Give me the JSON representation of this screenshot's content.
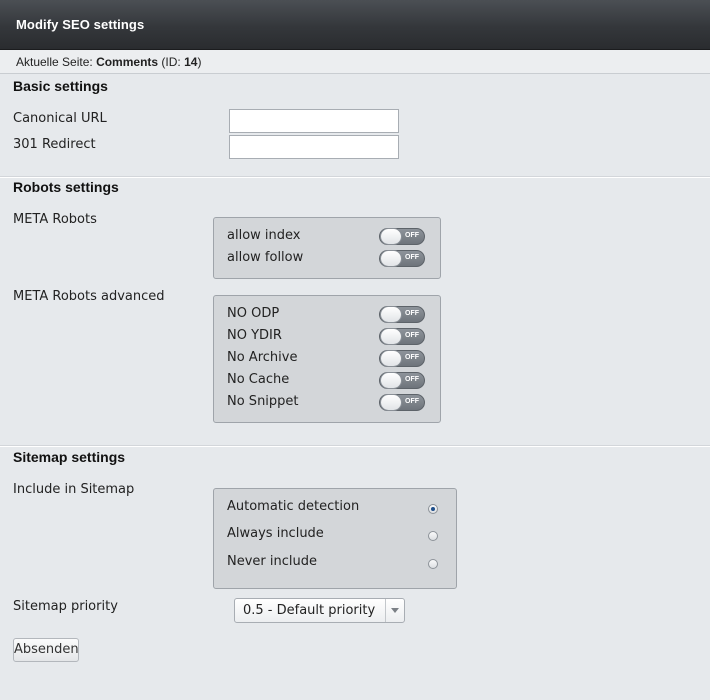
{
  "window": {
    "title": "Modify SEO settings"
  },
  "page_info": {
    "prefix": "Aktuelle Seite:",
    "page_name": "Comments",
    "id_prefix": "(ID:",
    "id_value": "14",
    "id_suffix": ")"
  },
  "basic": {
    "heading": "Basic settings",
    "canonical_label": "Canonical URL",
    "canonical_value": "",
    "redirect_label": "301 Redirect",
    "redirect_value": ""
  },
  "robots": {
    "heading": "Robots settings",
    "meta_label": "META Robots",
    "meta_options": [
      {
        "label": "allow index",
        "state": "OFF"
      },
      {
        "label": "allow follow",
        "state": "OFF"
      }
    ],
    "advanced_label": "META Robots advanced",
    "advanced_options": [
      {
        "label": "NO ODP",
        "state": "OFF"
      },
      {
        "label": "NO YDIR",
        "state": "OFF"
      },
      {
        "label": "No Archive",
        "state": "OFF"
      },
      {
        "label": "No Cache",
        "state": "OFF"
      },
      {
        "label": "No Snippet",
        "state": "OFF"
      }
    ]
  },
  "sitemap": {
    "heading": "Sitemap settings",
    "include_label": "Include in Sitemap",
    "include_options": [
      {
        "label": "Automatic detection",
        "selected": true
      },
      {
        "label": "Always include",
        "selected": false
      },
      {
        "label": "Never include",
        "selected": false
      }
    ],
    "priority_label": "Sitemap priority",
    "priority_value": "0.5 - Default priority"
  },
  "submit_label": "Absenden"
}
